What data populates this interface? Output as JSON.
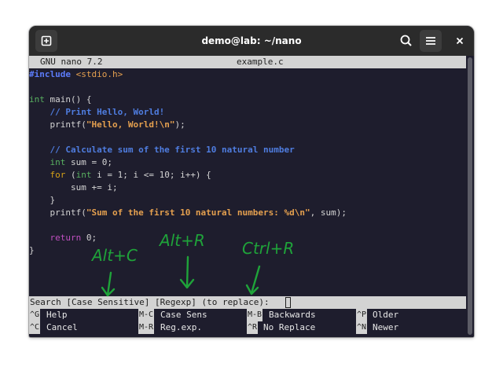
{
  "window": {
    "title": "demo@lab: ~/nano"
  },
  "nano": {
    "app": "GNU nano 7.2",
    "filename": "example.c"
  },
  "code": {
    "l1a": "#include",
    "l1b": " <stdio.h>",
    "l3a": "int",
    "l3b": " main() {",
    "l4": "    // Print Hello, World!",
    "l5a": "    printf(",
    "l5b": "\"Hello, World!\\n\"",
    "l5c": ");",
    "l7": "    // Calculate sum of the first 10 natural number",
    "l8a": "    int",
    "l8b": " sum = 0;",
    "l9a": "    for",
    "l9b": " (",
    "l9c": "int",
    "l9d": " i = 1; i <= 10; i++) {",
    "l10": "        sum += i;",
    "l11": "    }",
    "l12a": "    printf(",
    "l12b": "\"Sum of the first 10 natural numbers: %d\\n\"",
    "l12c": ", sum);",
    "l14a": "    return",
    "l14b": " 0;",
    "l15": "}"
  },
  "prompt": {
    "text": "Search [Case Sensitive] [Regexp] (to replace): "
  },
  "help": {
    "r1": [
      {
        "key": "^G",
        "label": "Help"
      },
      {
        "key": "M-C",
        "label": "Case Sens"
      },
      {
        "key": "M-B",
        "label": "Backwards"
      },
      {
        "key": "^P",
        "label": "Older"
      }
    ],
    "r2": [
      {
        "key": "^C",
        "label": "Cancel"
      },
      {
        "key": "M-R",
        "label": "Reg.exp."
      },
      {
        "key": "^R",
        "label": "No Replace"
      },
      {
        "key": "^N",
        "label": "Newer"
      }
    ]
  },
  "annotations": {
    "alt_c": "Alt+C",
    "alt_r": "Alt+R",
    "ctrl_r": "Ctrl+R"
  },
  "colors": {
    "annotation": "#1fa33a",
    "terminal_bg": "#1e1d2d",
    "bar_bg": "#d3d3d3"
  },
  "icons": [
    "new-tab-icon",
    "search-icon",
    "hamburger-menu-icon",
    "close-icon"
  ]
}
